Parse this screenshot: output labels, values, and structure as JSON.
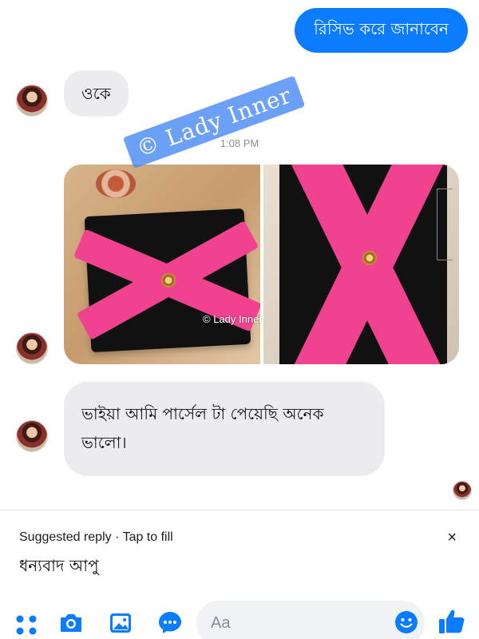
{
  "messages": {
    "outgoing_1": "রিসিভ করে জানাবেন",
    "incoming_1": "ওকে",
    "timestamp": "1:08 PM",
    "incoming_2": "ভাইয়া আমি পার্সেল টা পেয়েছি অনেক ভালো।"
  },
  "watermarks": {
    "large": "© Lady Inner",
    "small": "© Lady Inner"
  },
  "suggested_reply": {
    "header": "Suggested reply · Tap to fill",
    "text": "ধন্যবাদ আপু",
    "close_label": "×"
  },
  "composer": {
    "placeholder": "Aa"
  },
  "colors": {
    "accent": "#0b7bff",
    "incoming_bubble": "#ececee"
  },
  "icons": [
    "more-icon",
    "camera-icon",
    "gallery-icon",
    "messenger-icon",
    "emoji-icon",
    "like-icon"
  ]
}
